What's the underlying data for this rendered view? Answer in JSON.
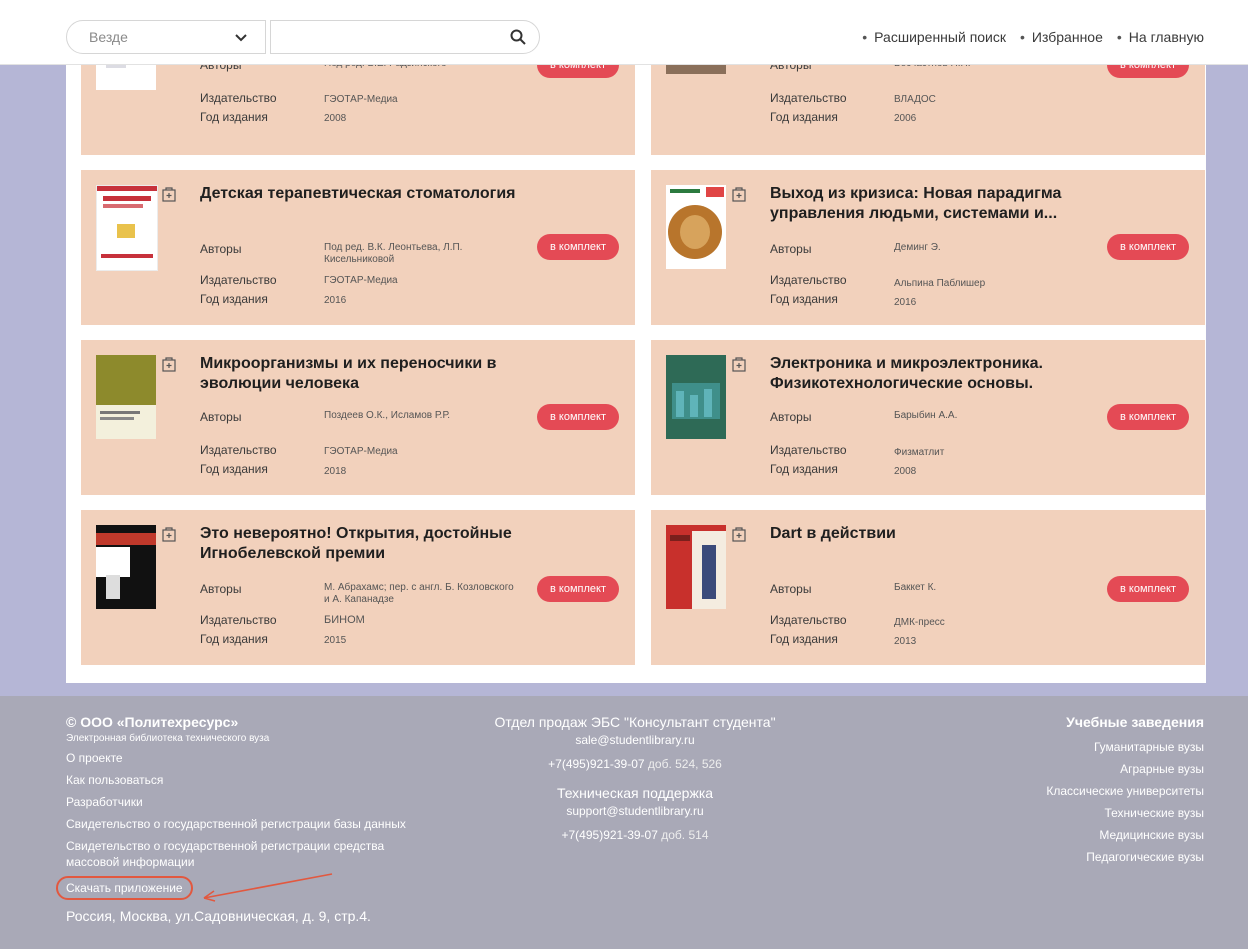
{
  "topbar": {
    "scope_value": "Везде",
    "search_placeholder": "",
    "links": [
      "Расширенный поиск",
      "Избранное",
      "На главную"
    ]
  },
  "labels": {
    "authors": "Авторы",
    "publisher": "Издательство",
    "year": "Год издания",
    "kit_button": "в комплект"
  },
  "books": [
    {
      "title": "",
      "authors": "Под ред. В.Е. Радзинского",
      "publisher": "ГЭОТАР-Медиа",
      "year": "2008"
    },
    {
      "title": "",
      "authors": "Бесчастнов Н.П.",
      "publisher": "ВЛАДОС",
      "year": "2006"
    },
    {
      "title": "Детская терапевтическая стоматология",
      "authors": "Под ред. В.К. Леонтьева, Л.П. Кисельниковой",
      "publisher": "ГЭОТАР-Медиа",
      "year": "2016"
    },
    {
      "title": "Выход из кризиса: Новая парадигма управления людьми, системами и...",
      "authors": "Деминг Э.",
      "publisher": "Альпина Паблишер",
      "year": "2016"
    },
    {
      "title": "Микроорганизмы и их переносчики в эволюции человека",
      "authors": "Поздеев О.К., Исламов Р.Р.",
      "publisher": "ГЭОТАР-Медиа",
      "year": "2018"
    },
    {
      "title": "Электроника и микроэлектроника. Физикотехнологические основы.",
      "authors": "Барыбин А.А.",
      "publisher": "Физматлит",
      "year": "2008"
    },
    {
      "title": "Это невероятно! Открытия, достойные Игнобелевской премии",
      "authors": "М. Абрахамс; пер. с англ. Б. Козловского и А. Капанадзе",
      "publisher": "БИНОМ",
      "year": "2015"
    },
    {
      "title": "Dart в действии",
      "authors": "Баккет К.",
      "publisher": "ДМК-пресс",
      "year": "2013"
    }
  ],
  "footer": {
    "company": "© ООО «Политехресурс»",
    "company_sub": "Электронная библиотека технического вуза",
    "links": [
      "О проекте",
      "Как пользоваться",
      "Разработчики",
      "Свидетельство о государственной регистрации базы данных",
      "Свидетельство о государственной регистрации средства массовой информации"
    ],
    "download": "Скачать приложение",
    "address": "Россия, Москва, ул.Садовническая, д. 9, стр.4.",
    "sales_heading": "Отдел продаж ЭБС \"Консультант студента\"",
    "sales_email": "sale@studentlibrary.ru",
    "sales_phone": "+7(495)921-39-07",
    "sales_ext": "доб. 524, 526",
    "support_heading": "Техническая поддержка",
    "support_email": "support@studentlibrary.ru",
    "support_phone": "+7(495)921-39-07",
    "support_ext": "доб. 514",
    "edu_heading": "Учебные заведения",
    "edu_links": [
      "Гуманитарные вузы",
      "Аграрные вузы",
      "Классические университеты",
      "Технические вузы",
      "Медицинские вузы",
      "Педагогические вузы"
    ]
  }
}
